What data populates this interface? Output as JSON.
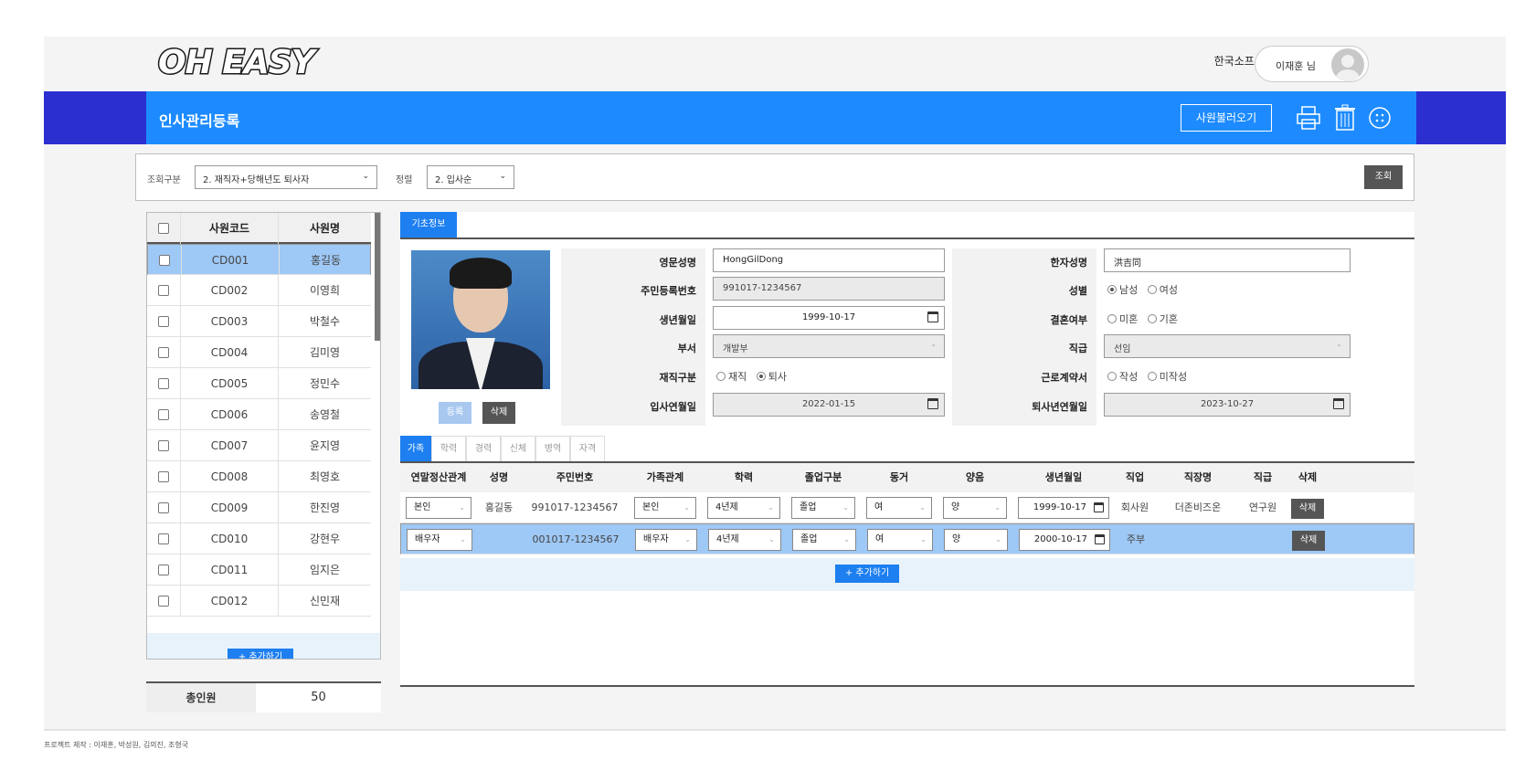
{
  "header": {
    "logo": "OH EASY",
    "org": "한국소프트웨어협회",
    "user": "이재훈 님"
  },
  "band": {
    "title": "인사관리등록",
    "load_button": "사원불러오기"
  },
  "search": {
    "label1": "조회구분",
    "select1": "2. 재직자+당해년도 퇴사자",
    "label2": "정렬",
    "select2": "2. 입사순",
    "button": "조회"
  },
  "employees": {
    "headers": {
      "code": "사원코드",
      "name": "사원명"
    },
    "rows": [
      {
        "code": "CD001",
        "name": "홍길동"
      },
      {
        "code": "CD002",
        "name": "이영희"
      },
      {
        "code": "CD003",
        "name": "박철수"
      },
      {
        "code": "CD004",
        "name": "김미영"
      },
      {
        "code": "CD005",
        "name": "정민수"
      },
      {
        "code": "CD006",
        "name": "송영철"
      },
      {
        "code": "CD007",
        "name": "윤지영"
      },
      {
        "code": "CD008",
        "name": "최영호"
      },
      {
        "code": "CD009",
        "name": "한진영"
      },
      {
        "code": "CD010",
        "name": "강현우"
      },
      {
        "code": "CD011",
        "name": "임지은"
      },
      {
        "code": "CD012",
        "name": "신민재"
      }
    ],
    "add_button": "+ 추가하기",
    "total_label": "총인원",
    "total_value": "50"
  },
  "detail": {
    "tab": "기초정보",
    "photo_register": "등록",
    "photo_delete": "삭제",
    "labels": {
      "eng_name": "영문성명",
      "rrn": "주민등록번호",
      "birth": "생년월일",
      "dept": "부서",
      "status": "재직구분",
      "join": "입사연월일",
      "hanja": "한자성명",
      "gender": "성별",
      "married": "결혼여부",
      "rank": "직급",
      "contract": "근로계약서",
      "leave": "퇴사년연월일"
    },
    "values": {
      "eng_name": "HongGilDong",
      "rrn": "991017-1234567",
      "birth": "1999-10-17",
      "dept": "개발부",
      "join": "2022-01-15",
      "hanja": "洪吉同",
      "rank": "선임",
      "leave": "2023-10-27"
    },
    "radios": {
      "status": [
        "재직",
        "퇴사"
      ],
      "gender": [
        "남성",
        "여성"
      ],
      "married": [
        "미혼",
        "기혼"
      ],
      "contract": [
        "작성",
        "미작성"
      ]
    }
  },
  "subtabs": [
    "가족",
    "학력",
    "경력",
    "신체",
    "병역",
    "자격"
  ],
  "family": {
    "headers": [
      "연말정산관계",
      "성명",
      "주민번호",
      "가족관계",
      "학력",
      "졸업구분",
      "동거",
      "양음",
      "생년월일",
      "직업",
      "직장명",
      "직급",
      "삭제"
    ],
    "rows": [
      {
        "relation": "본인",
        "name": "홍길동",
        "rrn": "991017-1234567",
        "family": "본인",
        "edu": "4년제",
        "grad": "졸업",
        "live": "여",
        "cal": "양",
        "birth": "1999-10-17",
        "job": "회사원",
        "company": "더존비즈온",
        "rank": "연구원",
        "del": "삭제"
      },
      {
        "relation": "배우자",
        "name": "",
        "rrn": "001017-1234567",
        "family": "배우자",
        "edu": "4년제",
        "grad": "졸업",
        "live": "여",
        "cal": "양",
        "birth": "2000-10-17",
        "job": "주부",
        "company": "",
        "rank": "",
        "del": "삭제"
      }
    ],
    "add_button": "+ 추가하기"
  },
  "footer": "프로젝트 제작 : 이재훈, 박성원, 김의진, 조형국",
  "colors": {
    "primary": "#1d8bff",
    "band_dark": "#2b2fd0",
    "selected_row": "#9ec8f5"
  }
}
